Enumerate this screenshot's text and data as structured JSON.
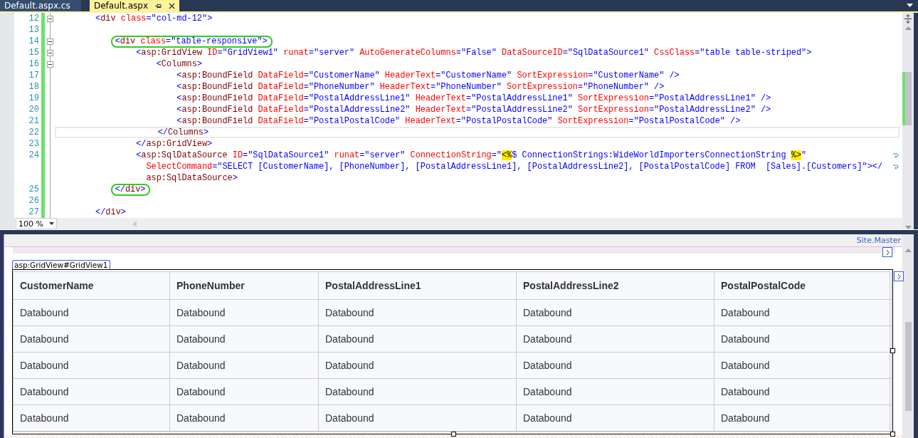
{
  "tabs": [
    {
      "label": "Default.aspx.cs",
      "selected": false
    },
    {
      "label": "Default.aspx",
      "selected": true
    }
  ],
  "editor": {
    "lines": [
      {
        "number": "12",
        "collapsible": true,
        "tokens": [
          {
            "kind": "delim",
            "text": "        <"
          },
          {
            "kind": "tag",
            "text": "div"
          },
          {
            "kind": "attr",
            "text": " class"
          },
          {
            "kind": "value",
            "text": "=\"col-md-12\""
          },
          {
            "kind": "delim",
            "text": ">"
          }
        ]
      },
      {
        "number": "13"
      },
      {
        "number": "14",
        "collapsible": true,
        "circled": true,
        "tokens": [
          {
            "kind": "delim",
            "text": "            <"
          },
          {
            "kind": "tag",
            "text": "div"
          },
          {
            "kind": "attr",
            "text": " class"
          },
          {
            "kind": "value",
            "text": "=\"table-responsive\""
          },
          {
            "kind": "delim",
            "text": ">"
          }
        ]
      },
      {
        "number": "15",
        "collapsible": true,
        "tokens": [
          {
            "kind": "delim",
            "text": "                <"
          },
          {
            "kind": "tag",
            "text": "asp:GridView"
          },
          {
            "kind": "attr",
            "text": " ID"
          },
          {
            "kind": "value",
            "text": "=\"GridView1\""
          },
          {
            "kind": "attr",
            "text": " runat"
          },
          {
            "kind": "value",
            "text": "=\"server\""
          },
          {
            "kind": "attr",
            "text": " AutoGenerateColumns"
          },
          {
            "kind": "value",
            "text": "=\"False\""
          },
          {
            "kind": "attr",
            "text": " DataSourceID"
          },
          {
            "kind": "value",
            "text": "=\"SqlDataSource1\""
          },
          {
            "kind": "attr",
            "text": " CssClass"
          },
          {
            "kind": "value",
            "text": "=\"table table-striped\""
          },
          {
            "kind": "delim",
            "text": ">"
          }
        ]
      },
      {
        "number": "16",
        "collapsible": true,
        "tokens": [
          {
            "kind": "delim",
            "text": "                    <"
          },
          {
            "kind": "tag",
            "text": "Columns"
          },
          {
            "kind": "delim",
            "text": ">"
          }
        ]
      },
      {
        "number": "17",
        "tokens": [
          {
            "kind": "delim",
            "text": "                        <"
          },
          {
            "kind": "tag",
            "text": "asp:BoundField"
          },
          {
            "kind": "attr",
            "text": " DataField"
          },
          {
            "kind": "value",
            "text": "=\"CustomerName\""
          },
          {
            "kind": "attr",
            "text": " HeaderText"
          },
          {
            "kind": "value",
            "text": "=\"CustomerName\""
          },
          {
            "kind": "attr",
            "text": " SortExpression"
          },
          {
            "kind": "value",
            "text": "=\"CustomerName\""
          },
          {
            "kind": "delim",
            "text": " />"
          }
        ]
      },
      {
        "number": "18",
        "tokens": [
          {
            "kind": "delim",
            "text": "                        <"
          },
          {
            "kind": "tag",
            "text": "asp:BoundField"
          },
          {
            "kind": "attr",
            "text": " DataField"
          },
          {
            "kind": "value",
            "text": "=\"PhoneNumber\""
          },
          {
            "kind": "attr",
            "text": " HeaderText"
          },
          {
            "kind": "value",
            "text": "=\"PhoneNumber\""
          },
          {
            "kind": "attr",
            "text": " SortExpression"
          },
          {
            "kind": "value",
            "text": "=\"PhoneNumber\""
          },
          {
            "kind": "delim",
            "text": " />"
          }
        ]
      },
      {
        "number": "19",
        "tokens": [
          {
            "kind": "delim",
            "text": "                        <"
          },
          {
            "kind": "tag",
            "text": "asp:BoundField"
          },
          {
            "kind": "attr",
            "text": " DataField"
          },
          {
            "kind": "value",
            "text": "=\"PostalAddressLine1\""
          },
          {
            "kind": "attr",
            "text": " HeaderText"
          },
          {
            "kind": "value",
            "text": "=\"PostalAddressLine1\""
          },
          {
            "kind": "attr",
            "text": " SortExpression"
          },
          {
            "kind": "value",
            "text": "=\"PostalAddressLine1\""
          },
          {
            "kind": "delim",
            "text": " />"
          }
        ]
      },
      {
        "number": "20",
        "tokens": [
          {
            "kind": "delim",
            "text": "                        <"
          },
          {
            "kind": "tag",
            "text": "asp:BoundField"
          },
          {
            "kind": "attr",
            "text": " DataField"
          },
          {
            "kind": "value",
            "text": "=\"PostalAddressLine2\""
          },
          {
            "kind": "attr",
            "text": " HeaderText"
          },
          {
            "kind": "value",
            "text": "=\"PostalAddressLine2\""
          },
          {
            "kind": "attr",
            "text": " SortExpression"
          },
          {
            "kind": "value",
            "text": "=\"PostalAddressLine2\""
          },
          {
            "kind": "delim",
            "text": " />"
          }
        ]
      },
      {
        "number": "21",
        "tokens": [
          {
            "kind": "delim",
            "text": "                        <"
          },
          {
            "kind": "tag",
            "text": "asp:BoundField"
          },
          {
            "kind": "attr",
            "text": " DataField"
          },
          {
            "kind": "value",
            "text": "=\"PostalPostalCode\""
          },
          {
            "kind": "attr",
            "text": " HeaderText"
          },
          {
            "kind": "value",
            "text": "=\"PostalPostalCode\""
          },
          {
            "kind": "attr",
            "text": " SortExpression"
          },
          {
            "kind": "value",
            "text": "=\"PostalPostalCode\""
          },
          {
            "kind": "delim",
            "text": " />"
          }
        ]
      },
      {
        "number": "22",
        "current": true,
        "tokens": [
          {
            "kind": "delim",
            "text": "                    </"
          },
          {
            "kind": "tag",
            "text": "Columns"
          },
          {
            "kind": "delim",
            "text": ">"
          }
        ]
      },
      {
        "number": "23",
        "tokens": [
          {
            "kind": "delim",
            "text": "                </"
          },
          {
            "kind": "tag",
            "text": "asp:GridView"
          },
          {
            "kind": "delim",
            "text": ">"
          }
        ]
      },
      {
        "number": "24",
        "wrapped": true,
        "tokens": [
          {
            "kind": "delim",
            "text": "                <"
          },
          {
            "kind": "tag",
            "text": "asp:SqlDataSource"
          },
          {
            "kind": "attr",
            "text": " ID"
          },
          {
            "kind": "value",
            "text": "=\"SqlDataSource1\""
          },
          {
            "kind": "attr",
            "text": " runat"
          },
          {
            "kind": "value",
            "text": "=\"server\""
          },
          {
            "kind": "attr",
            "text": " ConnectionString"
          },
          {
            "kind": "value",
            "text": "=\""
          },
          {
            "kind": "server",
            "text": "<%"
          },
          {
            "kind": "value",
            "text": "$ ConnectionStrings:WideWorldImportersConnectionString "
          },
          {
            "kind": "server",
            "text": "%>"
          },
          {
            "kind": "value",
            "text": "\""
          }
        ]
      },
      {
        "wrapped": true,
        "tokens": [
          {
            "kind": "attr",
            "text": "                  SelectCommand"
          },
          {
            "kind": "value",
            "text": "=\"SELECT [CustomerName], [PhoneNumber], [PostalAddressLine1], [PostalAddressLine2], [PostalPostalCode] FROM  [Sales].[Customers]\""
          },
          {
            "kind": "delim",
            "text": "></"
          }
        ]
      },
      {
        "tokens": [
          {
            "kind": "tag",
            "text": "                  asp:SqlDataSource"
          },
          {
            "kind": "delim",
            "text": ">"
          }
        ]
      },
      {
        "number": "25",
        "circled": true,
        "tokens": [
          {
            "kind": "delim",
            "text": "            </"
          },
          {
            "kind": "tag",
            "text": "div"
          },
          {
            "kind": "delim",
            "text": ">"
          }
        ]
      },
      {
        "number": "26"
      },
      {
        "number": "27",
        "tokens": [
          {
            "kind": "delim",
            "text": "        </"
          },
          {
            "kind": "tag",
            "text": "div"
          },
          {
            "kind": "delim",
            "text": ">"
          }
        ]
      }
    ],
    "zoom": "100 %"
  },
  "design": {
    "master_page": "Site.Master",
    "control_tag": "asp:GridView#GridView1",
    "table": {
      "columns": [
        "CustomerName",
        "PhoneNumber",
        "PostalAddressLine1",
        "PostalAddressLine2",
        "PostalPostalCode"
      ],
      "rows": [
        [
          "Databound",
          "Databound",
          "Databound",
          "Databound",
          "Databound"
        ],
        [
          "Databound",
          "Databound",
          "Databound",
          "Databound",
          "Databound"
        ],
        [
          "Databound",
          "Databound",
          "Databound",
          "Databound",
          "Databound"
        ],
        [
          "Databound",
          "Databound",
          "Databound",
          "Databound",
          "Databound"
        ],
        [
          "Databound",
          "Databound",
          "Databound",
          "Databound",
          "Databound"
        ]
      ]
    }
  }
}
